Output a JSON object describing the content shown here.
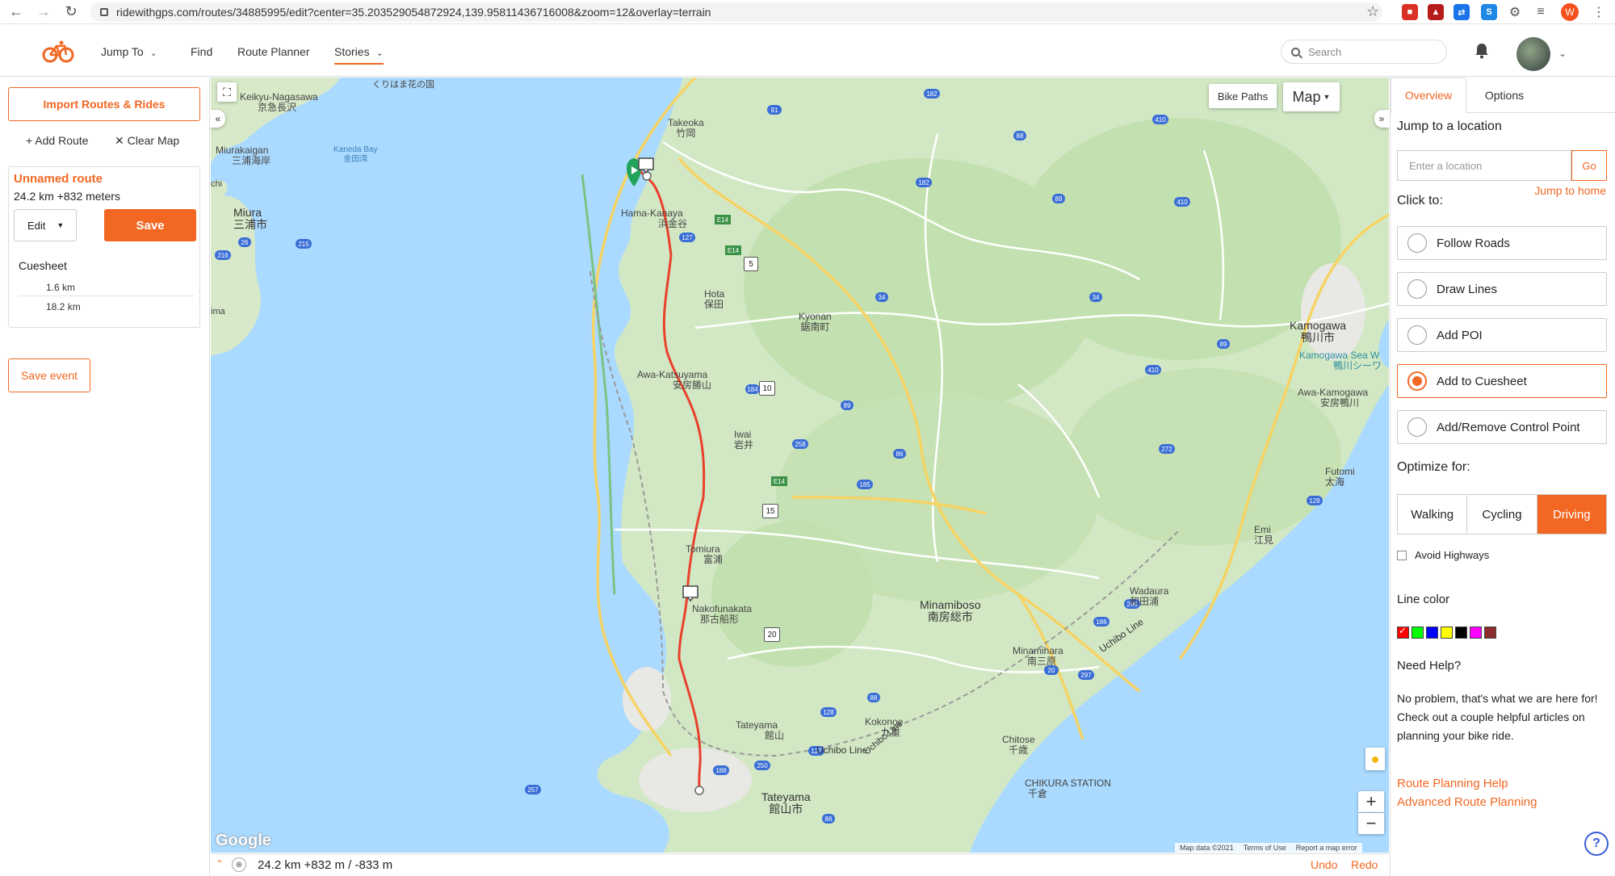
{
  "browser": {
    "url": "ridewithgps.com/routes/34885995/edit?center=35.203529054872924,139.95811436716008&zoom=12&overlay=terrain",
    "profile_initial": "W"
  },
  "header": {
    "nav": [
      "Jump To",
      "Find",
      "Route Planner",
      "Stories"
    ],
    "search_placeholder": "Search",
    "accent_color": "#f26722"
  },
  "left": {
    "import_label": "Import Routes & Rides",
    "add_route_label": "Add Route",
    "clear_map_label": "Clear Map",
    "route_name": "Unnamed route",
    "route_stats": "24.2 km  +832 meters",
    "edit_label": "Edit",
    "save_label": "Save",
    "cuesheet_title": "Cuesheet",
    "cues": [
      "1.6 km",
      "18.2 km"
    ],
    "save_event_label": "Save event"
  },
  "map": {
    "bike_paths_label": "Bike Paths",
    "map_type_label": "Map",
    "google_label": "Google",
    "attribution": [
      "Map data ©2021",
      "Terms of Use",
      "Report a map error"
    ],
    "places": [
      {
        "name": "Keikyu-Nagasawa",
        "jp": "京急長沢"
      },
      {
        "name": "Miurakaigan",
        "jp": "三浦海岸"
      },
      {
        "name": "Kaneda Bay",
        "jp": "金田湾"
      },
      {
        "name": "Miura",
        "jp": "三浦市"
      },
      {
        "name": "Takeoka",
        "jp": "竹岡"
      },
      {
        "name": "Hama-Kanaya",
        "jp": "浜金谷"
      },
      {
        "name": "Hota",
        "jp": "保田"
      },
      {
        "name": "Kyonan",
        "jp": "鋸南町"
      },
      {
        "name": "Awa-Katsuyama",
        "jp": "安房勝山"
      },
      {
        "name": "Iwai",
        "jp": "岩井"
      },
      {
        "name": "Tomiura",
        "jp": "富浦"
      },
      {
        "name": "Nakofunakata",
        "jp": "那古船形"
      },
      {
        "name": "Tateyama",
        "jp": "館山"
      },
      {
        "name": "Tateyama",
        "jp": "館山市"
      },
      {
        "name": "Kokonoe",
        "jp": "九重"
      },
      {
        "name": "Minamiboso",
        "jp": "南房総市"
      },
      {
        "name": "Minamihara",
        "jp": "南三原"
      },
      {
        "name": "Chitose",
        "jp": "千歳"
      },
      {
        "name": "CHIKURA STATION",
        "jp": "千倉"
      },
      {
        "name": "Wadaura",
        "jp": "和田浦"
      },
      {
        "name": "Emi",
        "jp": "江見"
      },
      {
        "name": "Futomi",
        "jp": "太海"
      },
      {
        "name": "Kamogawa",
        "jp": "鴨川市"
      },
      {
        "name": "Kamogawa Sea W",
        "jp": "鴨川シーワ"
      },
      {
        "name": "Awa-Kamogawa",
        "jp": "安房鴨川"
      }
    ],
    "line_labels": [
      "Uchibo Line",
      "Uchibo Line",
      "Uchibo Line"
    ],
    "misc_labels": [
      "くりはま花の国",
      "chi",
      "ima"
    ],
    "route_shields": [
      "5",
      "10",
      "15",
      "20",
      "E14",
      "E14",
      "E14"
    ],
    "road_shields": [
      "91",
      "182",
      "88",
      "410",
      "127",
      "34",
      "184",
      "89",
      "258",
      "86",
      "185",
      "272",
      "128",
      "296",
      "186",
      "297",
      "20",
      "26",
      "215",
      "216",
      "257",
      "188",
      "250",
      "86",
      "128",
      "88",
      "127",
      "410",
      "182",
      "89",
      "34",
      "410",
      "89"
    ]
  },
  "bottom": {
    "stats": "24.2 km +832 m / -833 m",
    "undo_label": "Undo",
    "redo_label": "Redo"
  },
  "right": {
    "tabs": [
      "Overview",
      "Options"
    ],
    "jump_heading": "Jump to a location",
    "location_placeholder": "Enter a location",
    "go_label": "Go",
    "jump_home_label": "Jump to home",
    "click_to_heading": "Click to:",
    "modes": [
      "Follow Roads",
      "Draw Lines",
      "Add POI",
      "Add to Cuesheet",
      "Add/Remove Control Point"
    ],
    "active_mode": "Add to Cuesheet",
    "optimize_heading": "Optimize for:",
    "optimize_options": [
      "Walking",
      "Cycling",
      "Driving"
    ],
    "optimize_selected": "Driving",
    "avoid_highways_label": "Avoid Highways",
    "avoid_highways_checked": false,
    "line_color_heading": "Line color",
    "line_colors": [
      "#ff0000",
      "#00ff00",
      "#0000ff",
      "#ffff00",
      "#000000",
      "#ff00ff",
      "#8b2b2b"
    ],
    "line_color_selected": "#ff0000",
    "help_heading": "Need Help?",
    "help_text": "No problem, that's what we are here for! Check out a couple helpful articles on planning your bike ride.",
    "help_links": [
      "Route Planning Help",
      "Advanced Route Planning"
    ]
  }
}
